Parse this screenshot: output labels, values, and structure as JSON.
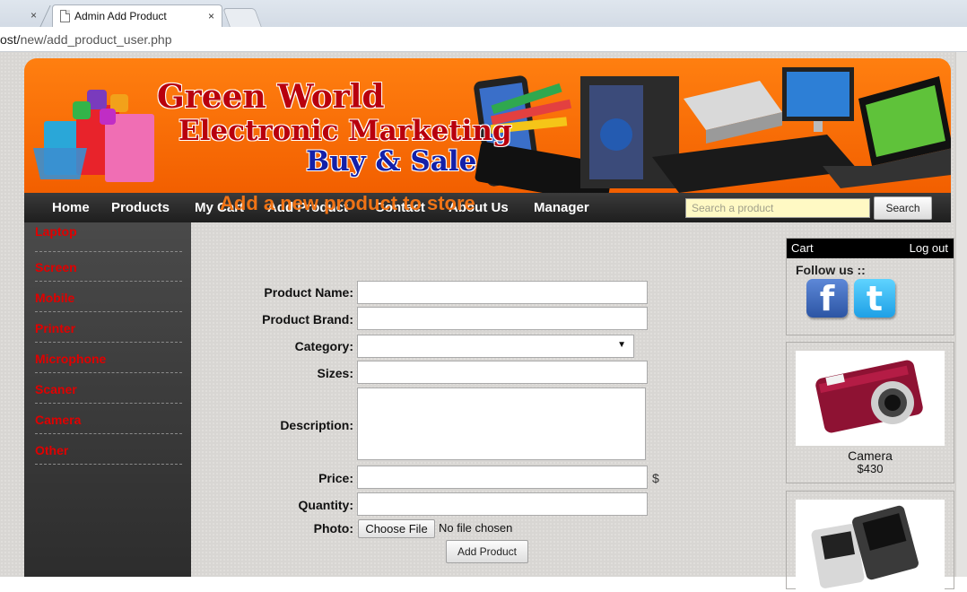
{
  "browser": {
    "tab_title": "Admin Add Product",
    "close_glyph": "×",
    "address_host": "ost/",
    "address_path": "new/add_product_user.php"
  },
  "banner": {
    "line1": "Green World",
    "line2": "Electronic Marketing",
    "line3": "Buy & Sale"
  },
  "nav": {
    "items": [
      "Home",
      "Products",
      "My Cart",
      "Add Product",
      "Contact",
      "About Us",
      "Manager"
    ],
    "search_placeholder": "Search a product",
    "search_button": "Search"
  },
  "sidebar": {
    "categories": [
      "Laptop",
      "Screen",
      "Mobile",
      "Printer",
      "Microphone",
      "Scaner",
      "Camera",
      "Other"
    ]
  },
  "form": {
    "heading": "Add a new product to store",
    "labels": {
      "name": "Product Name:",
      "brand": "Product Brand:",
      "category": "Category:",
      "sizes": "Sizes:",
      "description": "Description:",
      "price": "Price:",
      "quantity": "Quantity:",
      "photo": "Photo:"
    },
    "values": {
      "name": "",
      "brand": "",
      "category": "",
      "sizes": "",
      "description": "",
      "price": "",
      "quantity": ""
    },
    "currency": "$",
    "choose_file": "Choose File",
    "file_status": "No file chosen",
    "submit": "Add Product"
  },
  "right_panel": {
    "cart_label": "Cart",
    "logout_label": "Log out",
    "follow_label": "Follow us ::",
    "social_icons": [
      "facebook-icon",
      "twitter-icon"
    ],
    "products": [
      {
        "name": "Camera",
        "price": "$430"
      }
    ]
  },
  "colors": {
    "banner_orange": "#f25f00",
    "heading_orange": "#f07315",
    "category_red": "#e00000",
    "nav_dark": "#1e1e1e"
  }
}
